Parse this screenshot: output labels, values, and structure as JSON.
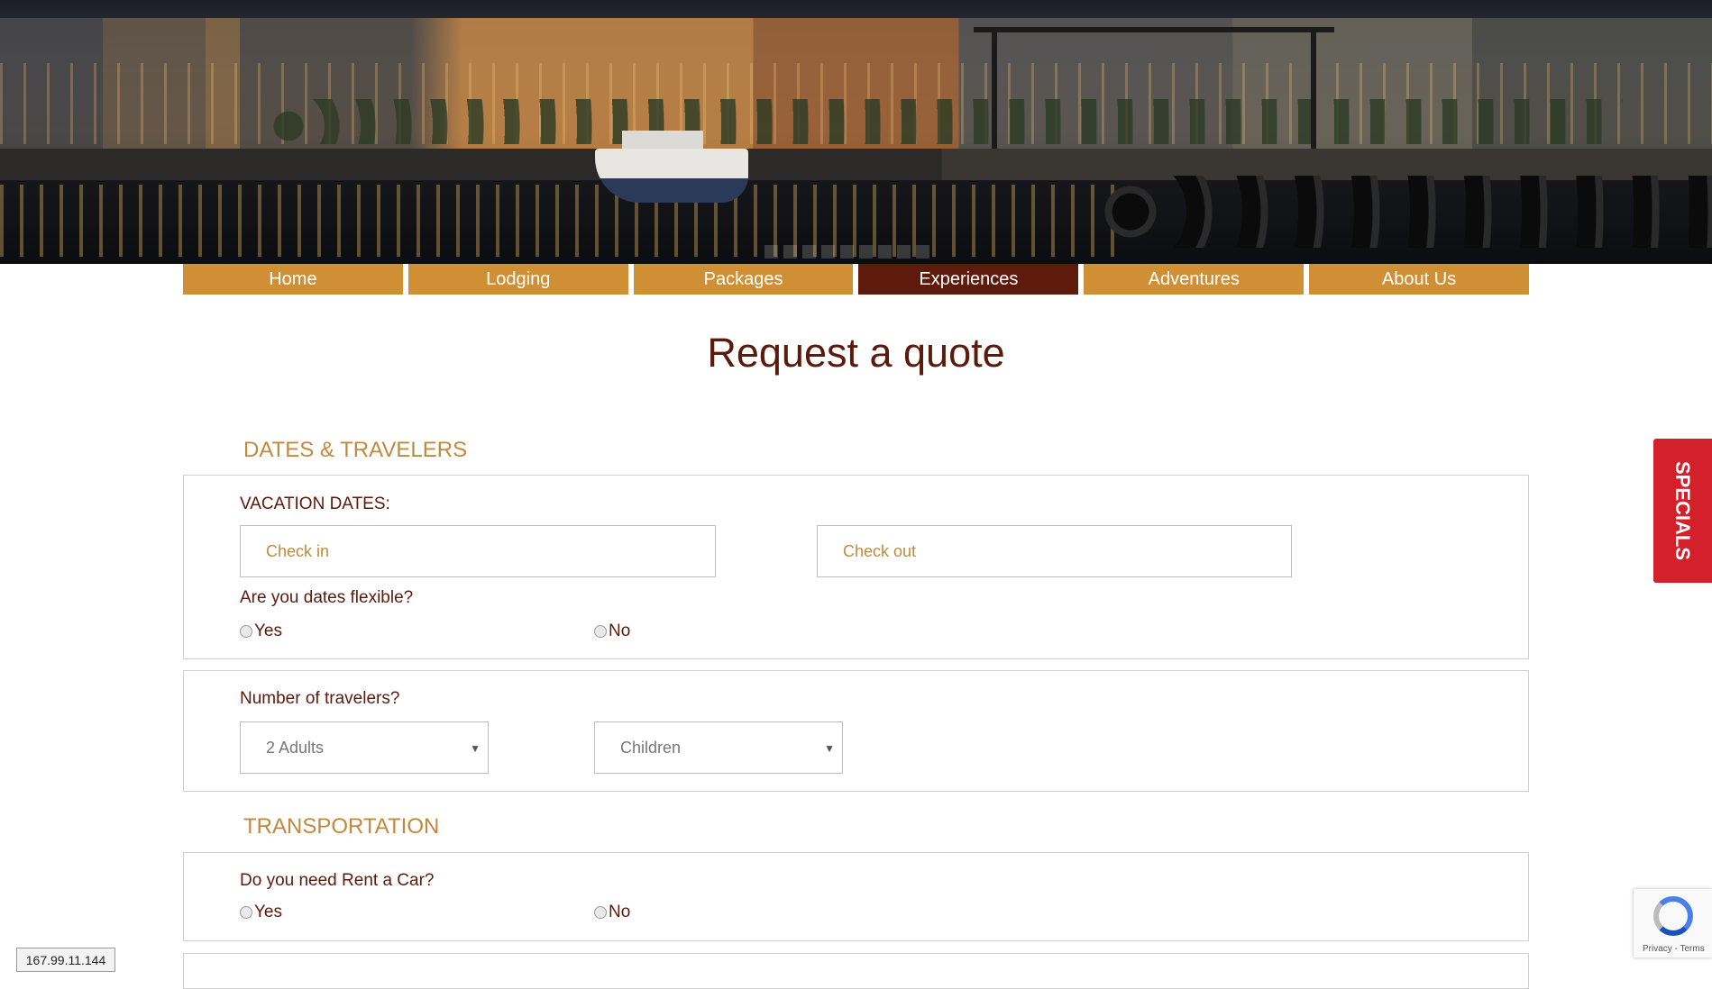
{
  "nav": {
    "items": [
      "Home",
      "Lodging",
      "Packages",
      "Experiences",
      "Adventures",
      "About Us"
    ],
    "active": "Experiences"
  },
  "page_title": "Request a quote",
  "dates_section": {
    "title": "DATES & TRAVELERS",
    "vacation_label": "VACATION DATES:",
    "checkin_placeholder": "Check in",
    "checkout_placeholder": "Check out",
    "flexible_question": "Are you dates flexible?",
    "yes_label": "Yes",
    "no_label": "No"
  },
  "travelers": {
    "question": "Number of travelers?",
    "adults_value": "2 Adults",
    "children_value": "Children"
  },
  "transport_section": {
    "title": "TRANSPORTATION",
    "question": "Do you need Rent a Car?",
    "yes_label": "Yes",
    "no_label": "No"
  },
  "specials_tab": "SPECIALS",
  "recaptcha": {
    "terms": "Privacy - Terms"
  },
  "ip_badge": "167.99.11.144",
  "colors": {
    "accent": "#d08f35",
    "active_nav": "#5e1a0b",
    "specials": "#d4202a",
    "section_title": "#c08a3e"
  }
}
